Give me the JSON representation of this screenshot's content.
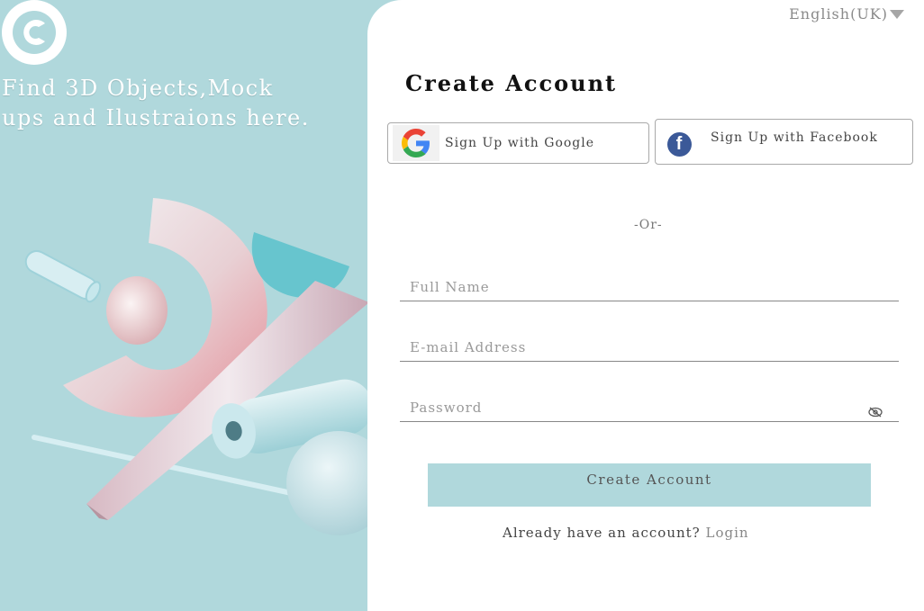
{
  "brand": {
    "logo_icon": "copyright-c-logo",
    "color": "#ffffff"
  },
  "hero": {
    "line1": "Find 3D Objects,Mock",
    "line2": "ups and Ilustraions here."
  },
  "header": {
    "language": "English(UK)"
  },
  "form": {
    "title": "Create Account",
    "google_label": "Sign Up with Google",
    "facebook_label": "Sign Up with Facebook",
    "divider": "-Or-",
    "full_name_placeholder": "Full Name",
    "email_placeholder": "E-mail Address",
    "password_placeholder": "Password",
    "submit_label": "Create  Account",
    "already_text": "Already have an account?",
    "login_label": "Login"
  },
  "colors": {
    "accent": "#b0d8dc",
    "facebook": "#3b5998",
    "text": "#111111"
  }
}
